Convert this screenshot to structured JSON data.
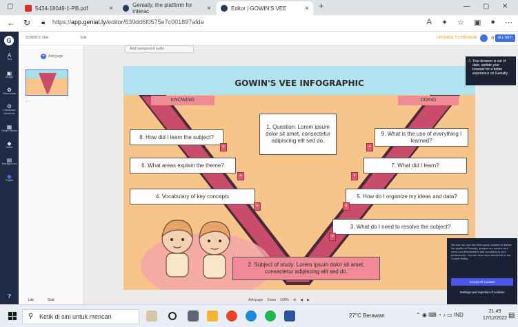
{
  "browser": {
    "tabs": [
      {
        "label": "5434-18049-1-PB.pdf",
        "close": "×"
      },
      {
        "label": "Genially, the platform for interac",
        "close": "×"
      },
      {
        "label": "Editor | GOWIN'S VEE",
        "close": "×"
      }
    ],
    "new_tab": "+",
    "url_prefix": "https://",
    "url_domain": "app.genial.ly",
    "url_path": "/editor/639dd6f0575e7c001897afda",
    "window_controls": [
      "—",
      "▢",
      "✕"
    ]
  },
  "rail": {
    "logo": "G",
    "items": [
      {
        "icon": "A",
        "label": "Text"
      },
      {
        "icon": "▣",
        "label": "Image"
      },
      {
        "icon": "✿",
        "label": "Resources"
      },
      {
        "icon": "⚙",
        "label": "Interactive elements"
      },
      {
        "icon": "▦",
        "label": "Smart blocks"
      },
      {
        "icon": "◆",
        "label": "Insert"
      },
      {
        "icon": "▤",
        "label": "Background"
      },
      {
        "icon": "◉",
        "label": "Pages"
      }
    ]
  },
  "editor_top": {
    "title": "GOWIN'S VEE",
    "edit_label": "Edit",
    "upgrade": "UPGRADE TO PREMIUM",
    "all_set": "ALL SET!"
  },
  "pages_panel": {
    "add_page": "Add page",
    "page_number": "1 / 1",
    "footer_left": "Lite",
    "footer_right": "Grid"
  },
  "canvas": {
    "background_audio": "Add background audio",
    "bottom_toolbar": [
      "Add page",
      "Zoom",
      "100%",
      "⊕",
      "◀",
      "▶"
    ]
  },
  "slide": {
    "title": "GOWIN'S VEE INFOGRAPHIC",
    "knowing": "KNOWING",
    "doing": "DOING",
    "question": "1. Question: Lorem ipsum dolor sit amet, consectetur adipiscing elit sed do.",
    "left_items": [
      "8. How did I learn the subject?",
      "6. What areas explain the theme?",
      "4. Vocabulary of key concepts"
    ],
    "right_items": [
      "9. What is the use of everything I learned?",
      "7. What did I learn?",
      "5. How do I organize my ideas and data?",
      "3. What do I need to resolve the subject?"
    ],
    "subject": "2. Subject of study: Lorem ipsum dolor sit amet, consectetur adipiscing elit sed do.",
    "plus": "+",
    "colors": {
      "sky": "#b0e3ef",
      "orange": "#f7c589",
      "pink": "#c94d6b",
      "header": "#ef8b95"
    }
  },
  "popup": {
    "text": "Your browser is out of date, update your browser for a better experience on Genially."
  },
  "cookie": {
    "text": "We use our own and third-party cookies to deliver the quality of Genially, analyze our service and show you personalized ads according to your preferences. You can read more about this in our Cookie Policy.",
    "accept": "Accept All Cookies",
    "manage": "Settings and rejection of cookies"
  },
  "taskbar": {
    "search_placeholder": "Ketik di sini untuk mencari",
    "weather": "27°C  Berawan",
    "lang": "IND",
    "time": "21.49",
    "date": "17/12/2022"
  }
}
